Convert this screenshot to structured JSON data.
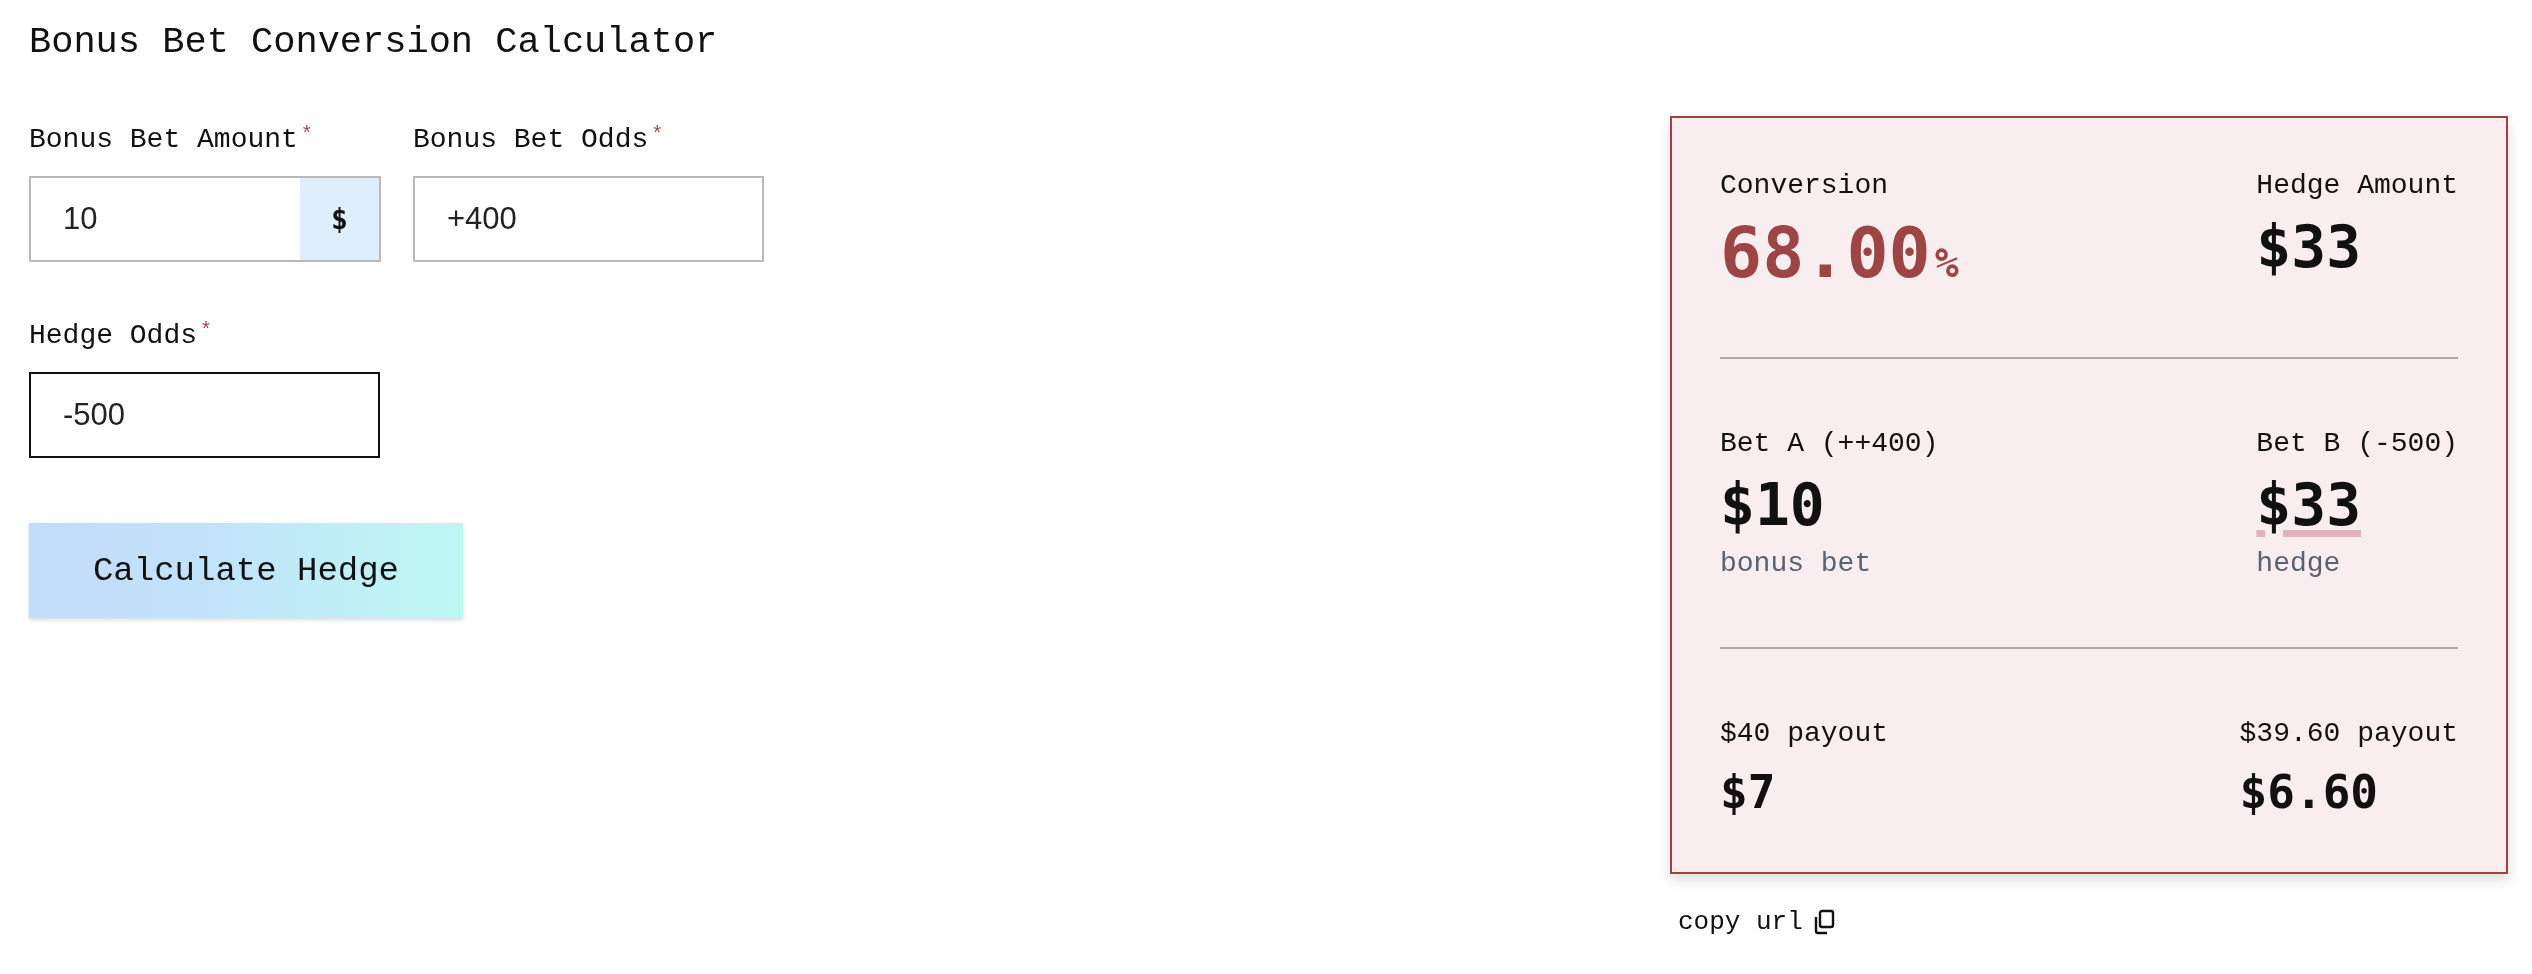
{
  "title": "Bonus Bet Conversion Calculator",
  "fields": [
    {
      "label": "Bonus Bet Amount",
      "required_mark": "*",
      "value": "10",
      "addon": "$",
      "focused": false
    },
    {
      "label": "Bonus Bet Odds",
      "required_mark": "*",
      "value": "+400",
      "focused": false
    },
    {
      "label": "Hedge Odds",
      "required_mark": "*",
      "value": "-500",
      "focused": true
    }
  ],
  "calculate_button": "Calculate Hedge",
  "results": {
    "conversion": {
      "label": "Conversion",
      "value": "68.00",
      "unit": "%"
    },
    "hedge_amount": {
      "label": "Hedge Amount",
      "value": "$33"
    },
    "bets": [
      {
        "label": "Bet A (++400)",
        "amount": "$10",
        "note": "bonus bet",
        "highlighted": false
      },
      {
        "label": "Bet B (-500)",
        "amount": "$33",
        "note": "hedge",
        "highlighted": true
      }
    ],
    "payouts": [
      {
        "label": "$40 payout",
        "value": "$7"
      },
      {
        "label": "$39.60 payout",
        "value": "$6.60"
      }
    ]
  },
  "copy_url": {
    "label": "copy url"
  }
}
